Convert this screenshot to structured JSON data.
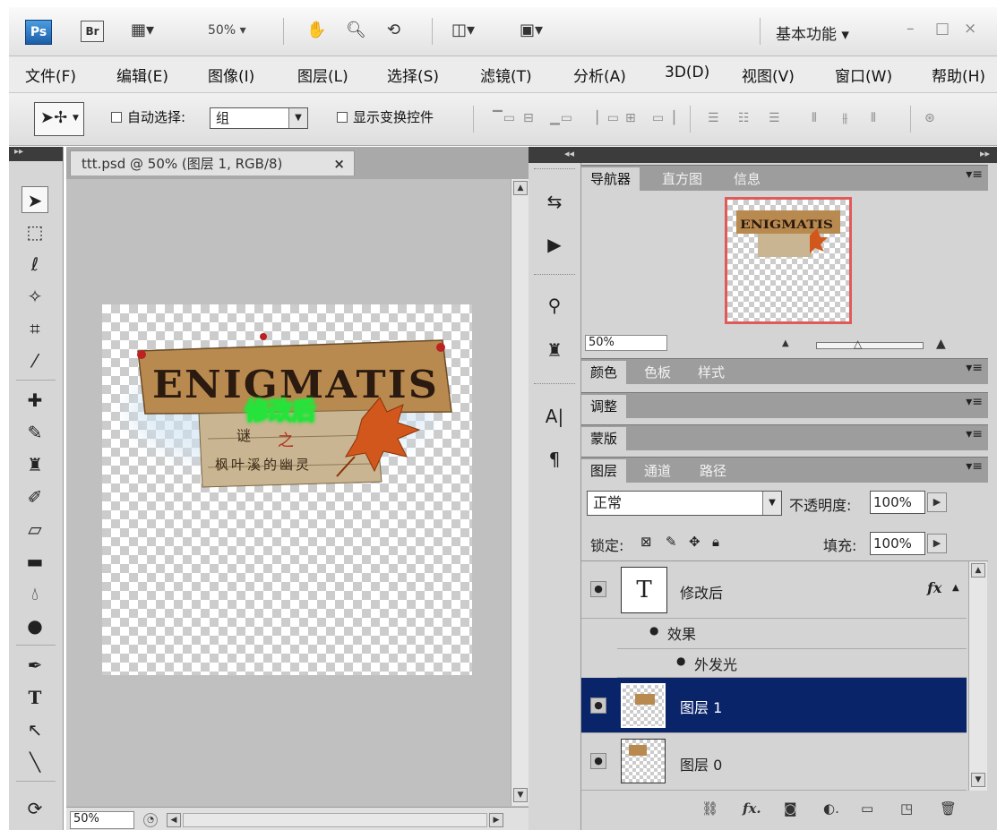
{
  "titlebar": {
    "ps_logo": "Ps",
    "br_logo": "Br",
    "zoom": "50%",
    "workspace": "基本功能",
    "icons": [
      "film-icon",
      "hand-icon",
      "zoom-icon",
      "rotate-view-icon",
      "arrange-icon",
      "screen-mode-icon"
    ]
  },
  "menu": [
    "文件(F)",
    "编辑(E)",
    "图像(I)",
    "图层(L)",
    "选择(S)",
    "滤镜(T)",
    "分析(A)",
    "3D(D)",
    "视图(V)",
    "窗口(W)",
    "帮助(H)"
  ],
  "options": {
    "auto_select_label": "自动选择:",
    "auto_select_value": "组",
    "show_transform_label": "显示变换控件"
  },
  "document": {
    "tab_title": "ttt.psd @ 50% (图层 1, RGB/8)",
    "tab_close": "×",
    "zoom": "50%"
  },
  "artwork": {
    "main_title": "ENIGMATIS",
    "overlay_text": "修改后",
    "sub_title_1": "谜",
    "sub_title_2": "之",
    "caption": "枫叶溪的幽灵",
    "colors": {
      "overlay_text": "#1a4cff",
      "overlay_glow": "#28e33a",
      "wood": "#b98a4f"
    }
  },
  "navigator": {
    "tabs": [
      "导航器",
      "直方图",
      "信息"
    ],
    "zoom": "50%"
  },
  "color_panel": {
    "tabs": [
      "颜色",
      "色板",
      "样式"
    ]
  },
  "adjust_panel": {
    "tabs": [
      "调整"
    ]
  },
  "mask_panel": {
    "tabs": [
      "蒙版"
    ]
  },
  "layers_panel": {
    "tabs": [
      "图层",
      "通道",
      "路径"
    ],
    "blend_mode": "正常",
    "opacity_label": "不透明度:",
    "opacity": "100%",
    "lock_label": "锁定:",
    "fill_label": "填充:",
    "fill": "100%",
    "layers": [
      {
        "name": "修改后",
        "type": "text",
        "thumb_glyph": "T",
        "fx": "fx"
      },
      {
        "name": "图层 1",
        "type": "pixel",
        "selected": true
      },
      {
        "name": "图层 0",
        "type": "pixel"
      }
    ],
    "effects_label": "效果",
    "effect_item": "外发光",
    "selected_color": "#0a246a"
  }
}
